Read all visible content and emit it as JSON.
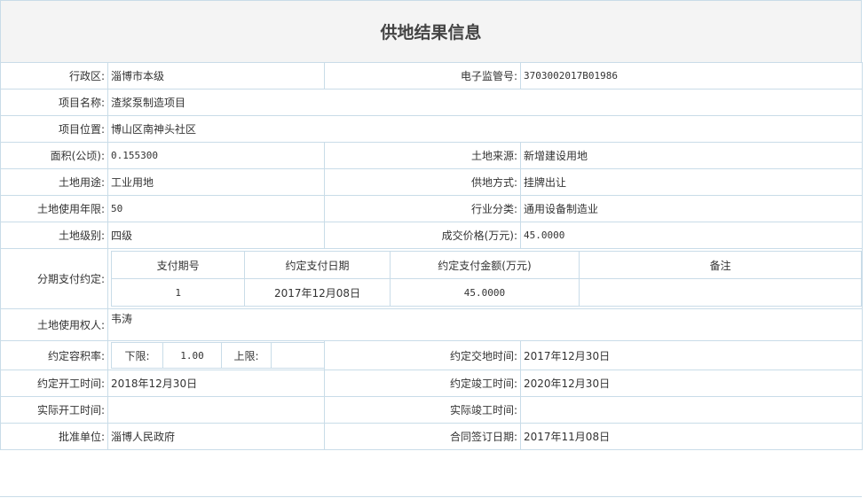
{
  "title": "供地结果信息",
  "fields": {
    "district_label": "行政区:",
    "district_value": "淄博市本级",
    "supervision_no_label": "电子监管号:",
    "supervision_no_value": "3703002017B01986",
    "project_name_label": "项目名称:",
    "project_name_value": "渣浆泵制造项目",
    "project_location_label": "项目位置:",
    "project_location_value": "博山区南神头社区",
    "area_label": "面积(公顷):",
    "area_value": "0.155300",
    "land_source_label": "土地来源:",
    "land_source_value": "新增建设用地",
    "land_use_label": "土地用途:",
    "land_use_value": "工业用地",
    "supply_method_label": "供地方式:",
    "supply_method_value": "挂牌出让",
    "use_years_label": "土地使用年限:",
    "use_years_value": "50",
    "industry_label": "行业分类:",
    "industry_value": "通用设备制造业",
    "land_grade_label": "土地级别:",
    "land_grade_value": "四级",
    "price_label": "成交价格(万元):",
    "price_value": "45.0000",
    "installment_label": "分期支付约定:",
    "owner_label": "土地使用权人:",
    "owner_value": "韦涛",
    "far_label": "约定容积率:",
    "far_lower_label": "下限:",
    "far_lower_value": "1.00",
    "far_upper_label": "上限:",
    "far_upper_value": "",
    "handover_label": "约定交地时间:",
    "handover_value": "2017年12月30日",
    "planned_start_label": "约定开工时间:",
    "planned_start_value": "2018年12月30日",
    "planned_finish_label": "约定竣工时间:",
    "planned_finish_value": "2020年12月30日",
    "actual_start_label": "实际开工时间:",
    "actual_start_value": "",
    "actual_finish_label": "实际竣工时间:",
    "actual_finish_value": "",
    "approver_label": "批准单位:",
    "approver_value": "淄博人民政府",
    "contract_date_label": "合同签订日期:",
    "contract_date_value": "2017年11月08日"
  },
  "installments": {
    "headers": [
      "支付期号",
      "约定支付日期",
      "约定支付金额(万元)",
      "备注"
    ],
    "rows": [
      [
        "1",
        "2017年12月08日",
        "45.0000",
        ""
      ]
    ]
  }
}
